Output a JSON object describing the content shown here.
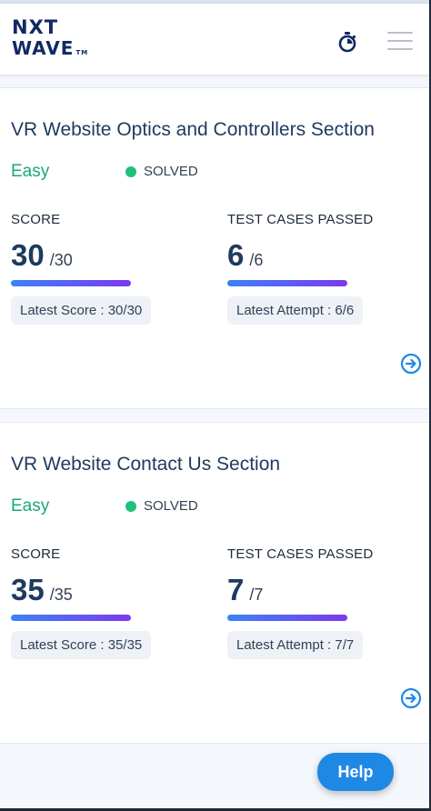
{
  "header": {
    "logo_line1": "NXT",
    "logo_line2": "WAVE",
    "logo_tm": "TM",
    "timer_icon": "stopwatch-icon",
    "menu_icon": "hamburger-menu-icon"
  },
  "cards": [
    {
      "title": "VR Website Optics and Controllers Section",
      "difficulty": "Easy",
      "status": "SOLVED",
      "score_label": "SCORE",
      "score_value": "30",
      "score_total": "/30",
      "score_progress": 1.0,
      "latest_score": "Latest Score : 30/30",
      "tests_label": "TEST CASES PASSED",
      "tests_value": "6",
      "tests_total": "/6",
      "tests_progress": 1.0,
      "latest_attempt": "Latest Attempt : 6/6",
      "arrow_icon": "arrow-right-circle-icon"
    },
    {
      "title": "VR Website Contact Us Section",
      "difficulty": "Easy",
      "status": "SOLVED",
      "score_label": "SCORE",
      "score_value": "35",
      "score_total": "/35",
      "score_progress": 1.0,
      "latest_score": "Latest Score : 35/35",
      "tests_label": "TEST CASES PASSED",
      "tests_value": "7",
      "tests_total": "/7",
      "tests_progress": 1.0,
      "latest_attempt": "Latest Attempt : 7/7",
      "arrow_icon": "arrow-right-circle-icon"
    }
  ],
  "help_button": {
    "label": "Help"
  },
  "colors": {
    "brand_navy": "#0f2a63",
    "easy_green": "#1aa872",
    "solved_dot": "#1ec17a",
    "bar_start": "#3b82f6",
    "bar_end": "#7c3aed",
    "help_blue": "#1e88e5"
  }
}
